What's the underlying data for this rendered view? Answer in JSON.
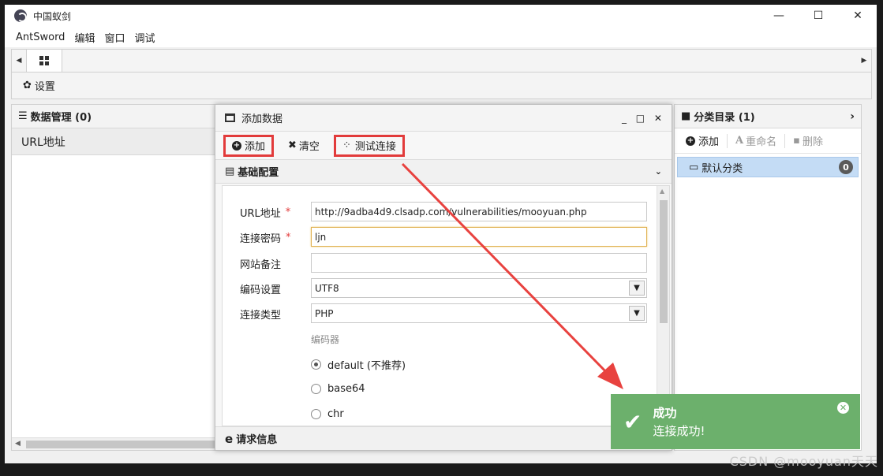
{
  "window": {
    "title": "中国蚁剑",
    "minimize": "—",
    "maximize": "☐",
    "close": "✕"
  },
  "menu": [
    "AntSword",
    "编辑",
    "窗口",
    "调试"
  ],
  "toolbar": {
    "settings_label": "设置"
  },
  "left_panel": {
    "title": "数据管理 (0)",
    "column": "URL地址"
  },
  "dialog": {
    "title": "添加数据",
    "controls": "_ □ ✕",
    "buttons": {
      "add": "添加",
      "clear": "清空",
      "test": "测试连接"
    },
    "section_basic": "基础配置",
    "section_request": "请求信息",
    "fields": {
      "url_label": "URL地址",
      "url_value": "http://9adba4d9.clsadp.com/vulnerabilities/mooyuan.php",
      "pass_label": "连接密码",
      "pass_value": "ljn",
      "note_label": "网站备注",
      "note_value": "",
      "encoding_label": "编码设置",
      "encoding_value": "UTF8",
      "type_label": "连接类型",
      "type_value": "PHP",
      "encoder_label": "编码器",
      "required_mark": "*"
    },
    "encoders": [
      {
        "label": "default (不推荐)",
        "checked": true
      },
      {
        "label": "base64",
        "checked": false
      },
      {
        "label": "chr",
        "checked": false
      }
    ]
  },
  "right_panel": {
    "title": "分类目录 (1)",
    "tools": {
      "add": "添加",
      "rename": "重命名",
      "delete": "删除"
    },
    "category": {
      "name": "默认分类",
      "count": "0"
    }
  },
  "toast": {
    "title": "成功",
    "message": "连接成功!"
  },
  "watermark": "CSDN @mooyuan天天",
  "colors": {
    "highlight": "#e23b3b",
    "toast": "#6cb06c",
    "selection": "#c4dcf5"
  }
}
